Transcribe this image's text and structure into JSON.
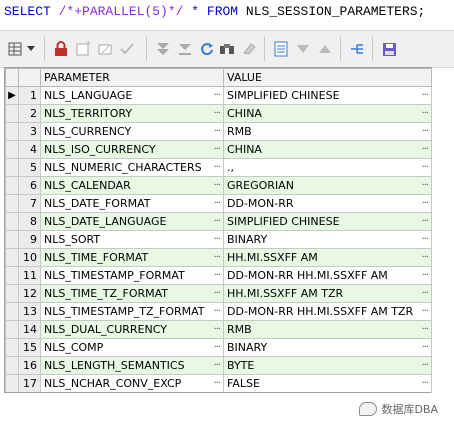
{
  "query": {
    "kw_select": "SELECT",
    "hint": "/*+PARALLEL(5)*/",
    "star": "*",
    "kw_from": "FROM",
    "table": "NLS_SESSION_PARAMETERS;"
  },
  "grid": {
    "columns": [
      "PARAMETER",
      "VALUE"
    ],
    "rows": [
      {
        "n": "1",
        "parameter": "NLS_LANGUAGE",
        "value": "SIMPLIFIED CHINESE"
      },
      {
        "n": "2",
        "parameter": "NLS_TERRITORY",
        "value": "CHINA"
      },
      {
        "n": "3",
        "parameter": "NLS_CURRENCY",
        "value": "RMB"
      },
      {
        "n": "4",
        "parameter": "NLS_ISO_CURRENCY",
        "value": "CHINA"
      },
      {
        "n": "5",
        "parameter": "NLS_NUMERIC_CHARACTERS",
        "value": ".,"
      },
      {
        "n": "6",
        "parameter": "NLS_CALENDAR",
        "value": "GREGORIAN"
      },
      {
        "n": "7",
        "parameter": "NLS_DATE_FORMAT",
        "value": "DD-MON-RR"
      },
      {
        "n": "8",
        "parameter": "NLS_DATE_LANGUAGE",
        "value": "SIMPLIFIED CHINESE"
      },
      {
        "n": "9",
        "parameter": "NLS_SORT",
        "value": "BINARY"
      },
      {
        "n": "10",
        "parameter": "NLS_TIME_FORMAT",
        "value": "HH.MI.SSXFF AM"
      },
      {
        "n": "11",
        "parameter": "NLS_TIMESTAMP_FORMAT",
        "value": "DD-MON-RR HH.MI.SSXFF AM"
      },
      {
        "n": "12",
        "parameter": "NLS_TIME_TZ_FORMAT",
        "value": "HH.MI.SSXFF AM TZR"
      },
      {
        "n": "13",
        "parameter": "NLS_TIMESTAMP_TZ_FORMAT",
        "value": "DD-MON-RR HH.MI.SSXFF AM TZR"
      },
      {
        "n": "14",
        "parameter": "NLS_DUAL_CURRENCY",
        "value": "RMB"
      },
      {
        "n": "15",
        "parameter": "NLS_COMP",
        "value": "BINARY"
      },
      {
        "n": "16",
        "parameter": "NLS_LENGTH_SEMANTICS",
        "value": "BYTE"
      },
      {
        "n": "17",
        "parameter": "NLS_NCHAR_CONV_EXCP",
        "value": "FALSE"
      }
    ],
    "current_row_marker": "▶",
    "ellipsis": "···"
  },
  "watermark": {
    "text": "数据库DBA"
  },
  "toolbar": {
    "icons": [
      "grid-options-icon",
      "dropdown-arrow-icon",
      "lock-icon",
      "new-record-icon",
      "delete-record-icon",
      "post-icon",
      "first-record-icon",
      "last-record-icon",
      "refresh-icon",
      "find-icon",
      "clear-icon",
      "export-icon",
      "filter-down-icon",
      "filter-up-icon",
      "link-icon",
      "save-icon"
    ]
  },
  "colors": {
    "even_row": "#e8f8e3",
    "keyword": "#0000cc",
    "hint": "#8a2be2"
  }
}
